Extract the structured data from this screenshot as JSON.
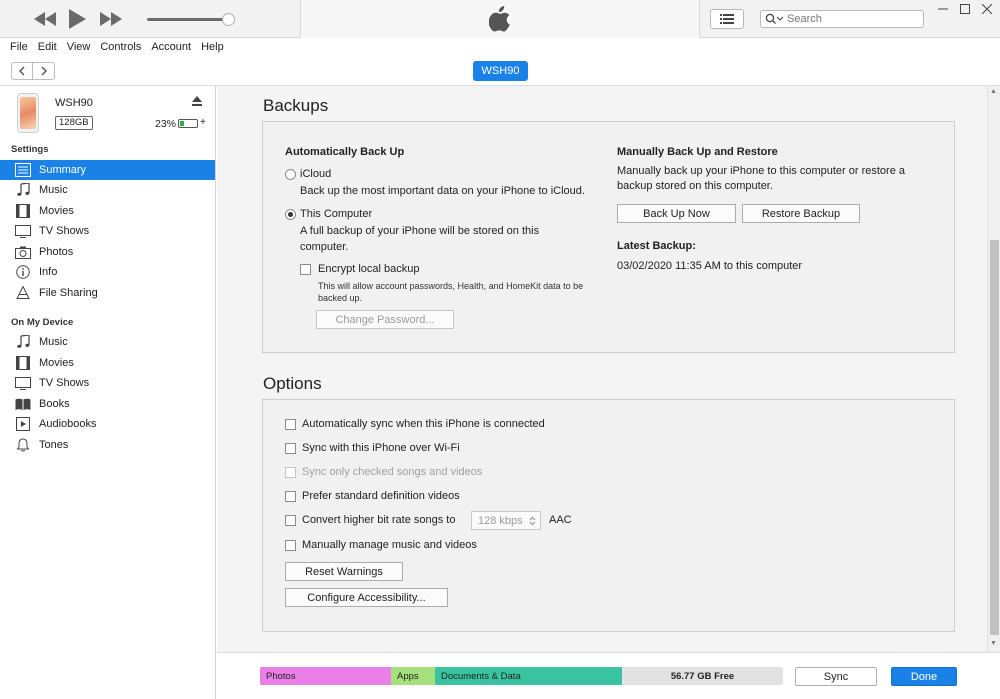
{
  "player": {
    "search_placeholder": "Search"
  },
  "menu": [
    "File",
    "Edit",
    "View",
    "Controls",
    "Account",
    "Help"
  ],
  "device_tab": "WSH90",
  "device": {
    "name": "WSH90",
    "capacity": "128GB",
    "battery_pct": "23%",
    "battery_level": 0.23,
    "battery_plug": "+"
  },
  "sidebar": {
    "settings_head": "Settings",
    "settings_items": [
      {
        "label": "Summary",
        "icon": "summary-icon",
        "active": true
      },
      {
        "label": "Music",
        "icon": "music-note-icon"
      },
      {
        "label": "Movies",
        "icon": "film-icon"
      },
      {
        "label": "TV Shows",
        "icon": "tv-icon"
      },
      {
        "label": "Photos",
        "icon": "camera-icon"
      },
      {
        "label": "Info",
        "icon": "info-icon"
      },
      {
        "label": "File Sharing",
        "icon": "apps-icon"
      }
    ],
    "device_head": "On My Device",
    "device_items": [
      {
        "label": "Music",
        "icon": "music-note-icon"
      },
      {
        "label": "Movies",
        "icon": "film-icon"
      },
      {
        "label": "TV Shows",
        "icon": "tv-icon"
      },
      {
        "label": "Books",
        "icon": "book-icon"
      },
      {
        "label": "Audiobooks",
        "icon": "audiobook-icon"
      },
      {
        "label": "Tones",
        "icon": "bell-icon"
      }
    ]
  },
  "backups": {
    "title": "Backups",
    "auto_title": "Automatically Back Up",
    "icloud_label": "iCloud",
    "icloud_desc": "Back up the most important data on your iPhone to iCloud.",
    "computer_label": "This Computer",
    "computer_desc_1": "A full backup of your iPhone will be stored on this",
    "computer_desc_2": "computer.",
    "encrypt_label": "Encrypt local backup",
    "encrypt_desc_1": "This will allow account passwords, Health, and HomeKit data to be",
    "encrypt_desc_2": "backed up.",
    "change_password": "Change Password...",
    "manual_title": "Manually Back Up and Restore",
    "manual_desc_1": "Manually back up your iPhone to this computer or restore a",
    "manual_desc_2": "backup stored on this computer.",
    "backup_now": "Back Up Now",
    "restore_backup": "Restore Backup",
    "latest_title": "Latest Backup:",
    "latest_value": "03/02/2020 11:35 AM to this computer"
  },
  "options": {
    "title": "Options",
    "items": [
      "Automatically sync when this iPhone is connected",
      "Sync with this iPhone over Wi-Fi",
      "Sync only checked songs and videos",
      "Prefer standard definition videos",
      "Convert higher bit rate songs to",
      "Manually manage music and videos"
    ],
    "bitrate": "128 kbps",
    "format": "AAC",
    "reset_warnings": "Reset Warnings",
    "configure_accessibility": "Configure Accessibility..."
  },
  "storage": {
    "photos": "Photos",
    "apps": "Apps",
    "docs": "Documents & Data",
    "free": "56.77 GB Free",
    "colors": {
      "photos": "#ea7fe8",
      "apps": "#a6e07c",
      "docs": "#39c3a0",
      "free": "#e2e2e2"
    }
  },
  "buttons": {
    "sync": "Sync",
    "done": "Done"
  }
}
